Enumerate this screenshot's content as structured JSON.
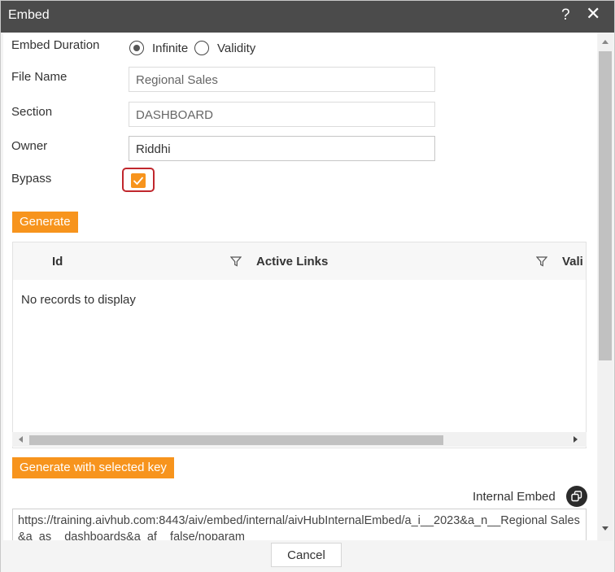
{
  "dialog": {
    "title": "Embed",
    "help_icon": "?",
    "close_icon": "✕"
  },
  "form": {
    "embed_duration": {
      "label": "Embed Duration",
      "options": [
        "Infinite",
        "Validity"
      ],
      "selected": "Infinite"
    },
    "file_name": {
      "label": "File Name",
      "value": "Regional Sales"
    },
    "section": {
      "label": "Section",
      "value": "DASHBOARD"
    },
    "owner": {
      "label": "Owner",
      "value": "Riddhi"
    },
    "bypass": {
      "label": "Bypass",
      "checked": true
    }
  },
  "buttons": {
    "generate": "Generate",
    "generate_selected": "Generate with selected key",
    "cancel": "Cancel"
  },
  "grid": {
    "columns": [
      "Id",
      "Active Links",
      "Vali"
    ],
    "empty_text": "No records to display"
  },
  "embed": {
    "label": "Internal Embed",
    "url": "https://training.aivhub.com:8443/aiv/embed/internal/aivHubInternalEmbed/a_i__2023&a_n__Regional Sales&a_as__dashboards&a_af__false/noparam"
  },
  "colors": {
    "accent": "#f7941d",
    "titlebar": "#4b4b4b",
    "highlight_border": "#c0272d"
  }
}
